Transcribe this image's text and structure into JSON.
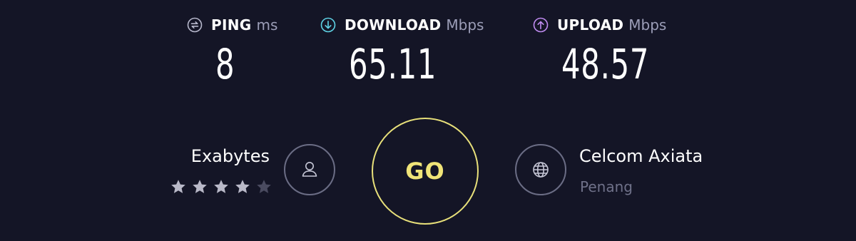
{
  "metrics": {
    "ping": {
      "label": "PING",
      "unit": "ms",
      "value": "8",
      "icon": "ping-icon",
      "color": "#b7b8cc"
    },
    "download": {
      "label": "DOWNLOAD",
      "unit": "Mbps",
      "value": "65.11",
      "icon": "download-icon",
      "color": "#5fd3e6"
    },
    "upload": {
      "label": "UPLOAD",
      "unit": "Mbps",
      "value": "48.57",
      "icon": "upload-icon",
      "color": "#c18cf2"
    }
  },
  "provider": {
    "name": "Exabytes",
    "rating": 4,
    "rating_max": 5,
    "icon": "user-icon"
  },
  "go_button": {
    "label": "GO",
    "color": "#f0e478"
  },
  "server": {
    "name": "Celcom Axiata",
    "location": "Penang",
    "icon": "globe-icon"
  },
  "colors": {
    "background": "#141526",
    "star_filled": "#b9b9c8",
    "star_empty": "#4a4b60"
  }
}
